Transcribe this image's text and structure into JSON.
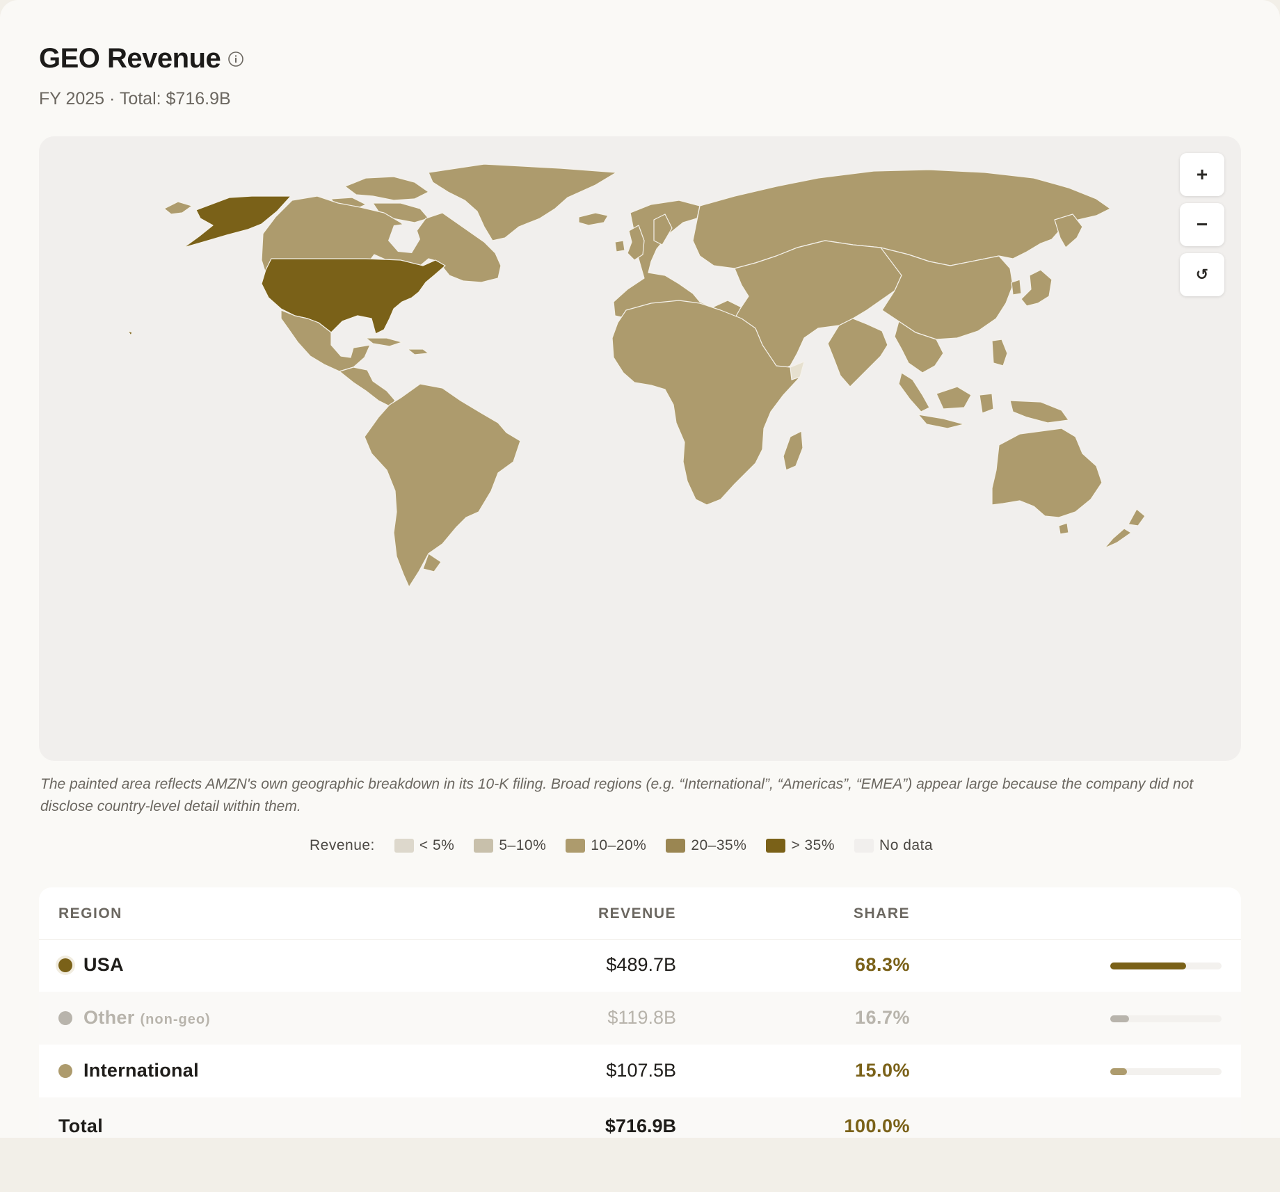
{
  "header": {
    "title": "GEO Revenue",
    "subtitle": "FY 2025 · Total: $716.9B"
  },
  "map": {
    "zoom_in_label": "+",
    "zoom_out_label": "−",
    "reset_label": "↺",
    "colors": {
      "background": "#f1efed",
      "usa": "#7a6118",
      "international": "#ad9b6d",
      "border": "#f4f1ea"
    }
  },
  "note": "The painted area reflects AMZN's own geographic breakdown in its 10-K filing. Broad regions (e.g. “International”, “Americas”, “EMEA”) appear large because the company did not disclose country-level detail within them.",
  "legend": {
    "title": "Revenue:",
    "items": [
      {
        "label": "< 5%",
        "color": "#ddd8cc"
      },
      {
        "label": "5–10%",
        "color": "#c8c0ab"
      },
      {
        "label": "10–20%",
        "color": "#ad9b6d"
      },
      {
        "label": "20–35%",
        "color": "#9a8652"
      },
      {
        "label": "> 35%",
        "color": "#7a6118"
      },
      {
        "label": "No data",
        "color": "#f1efed"
      }
    ]
  },
  "table": {
    "headers": {
      "region": "REGION",
      "revenue": "REVENUE",
      "share": "SHARE"
    },
    "rows": [
      {
        "region": "USA",
        "sub": "",
        "revenue": "$489.7B",
        "share": "68.3%",
        "share_fraction": 0.683,
        "color": "#7a6118"
      },
      {
        "region": "Other",
        "sub": "(non-geo)",
        "revenue": "$119.8B",
        "share": "16.7%",
        "share_fraction": 0.167,
        "color": "#b8b4ac"
      },
      {
        "region": "International",
        "sub": "",
        "revenue": "$107.5B",
        "share": "15.0%",
        "share_fraction": 0.15,
        "color": "#ad9b6d"
      }
    ],
    "total": {
      "label": "Total",
      "revenue": "$716.9B",
      "share": "100.0%"
    }
  }
}
